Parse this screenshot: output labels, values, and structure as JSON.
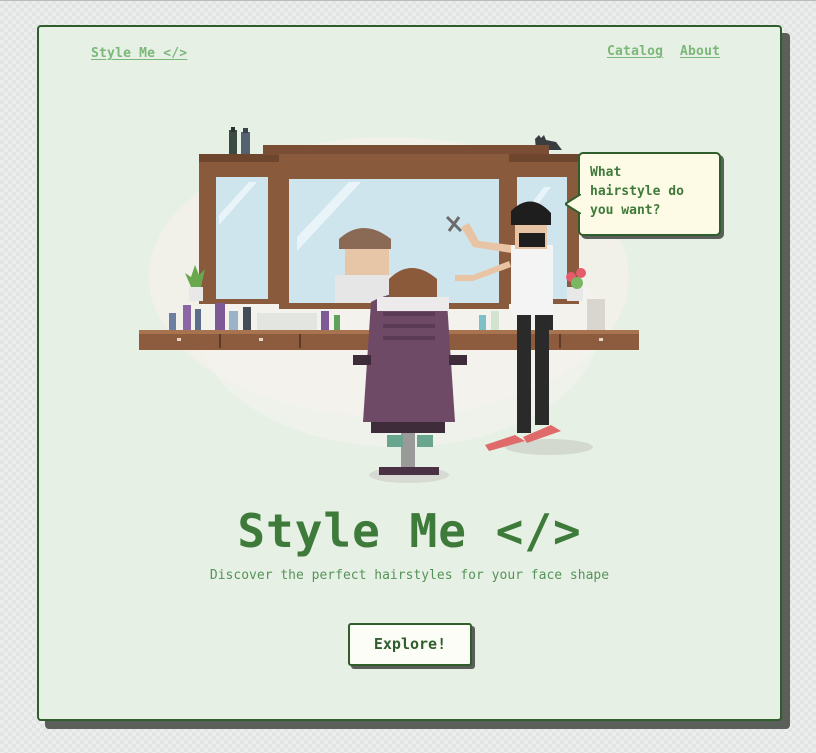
{
  "nav": {
    "brand": "Style Me </>",
    "links": [
      "Catalog",
      "About"
    ]
  },
  "illustration": {
    "speech_bubble": [
      "What",
      "hairstyle do",
      "you want?"
    ]
  },
  "hero": {
    "title": "Style Me </>",
    "subtitle": "Discover the perfect hairstyles for your face shape",
    "cta_label": "Explore!"
  },
  "colors": {
    "card_background": "#e6f0e4",
    "accent_green": "#3e7a3a",
    "light_green_link": "#7cb77a",
    "border": "#2f5e2c",
    "shadow": "#5a5f5a"
  }
}
